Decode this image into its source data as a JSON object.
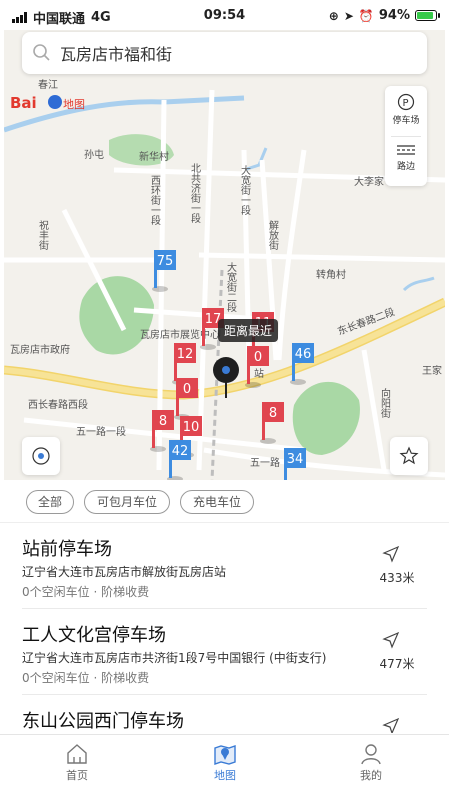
{
  "status_bar": {
    "carrier": "中国联通",
    "network": "4G",
    "time": "09:54",
    "battery": "94%",
    "battery_level": 0.94
  },
  "search": {
    "value": "瓦房店市福和街"
  },
  "map": {
    "logo_text": "Bai",
    "logo_text2": "地图",
    "tools": [
      {
        "label": "停车场",
        "icon": "parking-icon"
      },
      {
        "label": "路边",
        "icon": "roadside-icon"
      }
    ],
    "nearest_label": "距离最近",
    "place_labels": {
      "chunjiang": "春江",
      "sunzhen": "孙屯",
      "xinhuacun": "新华村",
      "beigongji": "北共济街一段",
      "xihuan": "西环街一段",
      "dakuan": "大宽街一段",
      "dakuan2": "大宽街二段",
      "jiefang": "解放街",
      "zhufeng": "祝丰街",
      "dali": "大李家",
      "zhuanjiao": "转角村",
      "gov": "瓦房店市政府",
      "expo": "瓦房店市展览中心",
      "dongchangchun": "东长春路二段",
      "xichangchun": "西长春路西段",
      "wuyi": "五一路一段",
      "wuyi2": "五一路",
      "xiangyang": "向阳街",
      "wangjia": "王家",
      "station": "站"
    },
    "markers": [
      {
        "count": "75",
        "kind": "blue"
      },
      {
        "count": "17",
        "kind": "red"
      },
      {
        "count": "11",
        "kind": "red"
      },
      {
        "count": "12",
        "kind": "red"
      },
      {
        "count": "0",
        "kind": "red"
      },
      {
        "count": "46",
        "kind": "blue"
      },
      {
        "count": "0",
        "kind": "red"
      },
      {
        "count": "8",
        "kind": "red"
      },
      {
        "count": "10",
        "kind": "red"
      },
      {
        "count": "8",
        "kind": "red"
      },
      {
        "count": "42",
        "kind": "blue"
      },
      {
        "count": "34",
        "kind": "blue"
      }
    ]
  },
  "filters": [
    "全部",
    "可包月车位",
    "充电车位"
  ],
  "parking_lots": [
    {
      "name": "站前停车场",
      "address": "辽宁省大连市瓦房店市解放街瓦房店站",
      "availability": "0个空闲车位 · 阶梯收费",
      "distance": "433米"
    },
    {
      "name": "工人文化宫停车场",
      "address": "辽宁省大连市瓦房店市共济街1段7号中国银行 (中街支行)",
      "availability": "0个空闲车位 · 阶梯收费",
      "distance": "477米"
    },
    {
      "name": "东山公园西门停车场",
      "address": "",
      "availability": "",
      "distance": ""
    }
  ],
  "tabs": [
    {
      "label": "首页",
      "icon": "home-icon",
      "active": false
    },
    {
      "label": "地图",
      "icon": "map-icon",
      "active": true
    },
    {
      "label": "我的",
      "icon": "profile-icon",
      "active": false
    }
  ],
  "colors": {
    "accent": "#3a7bd5",
    "marker_red": "#e0454f",
    "marker_blue": "#3d8ce0",
    "park_green": "#a9d8a5",
    "road_yellow": "#f2d46b"
  }
}
